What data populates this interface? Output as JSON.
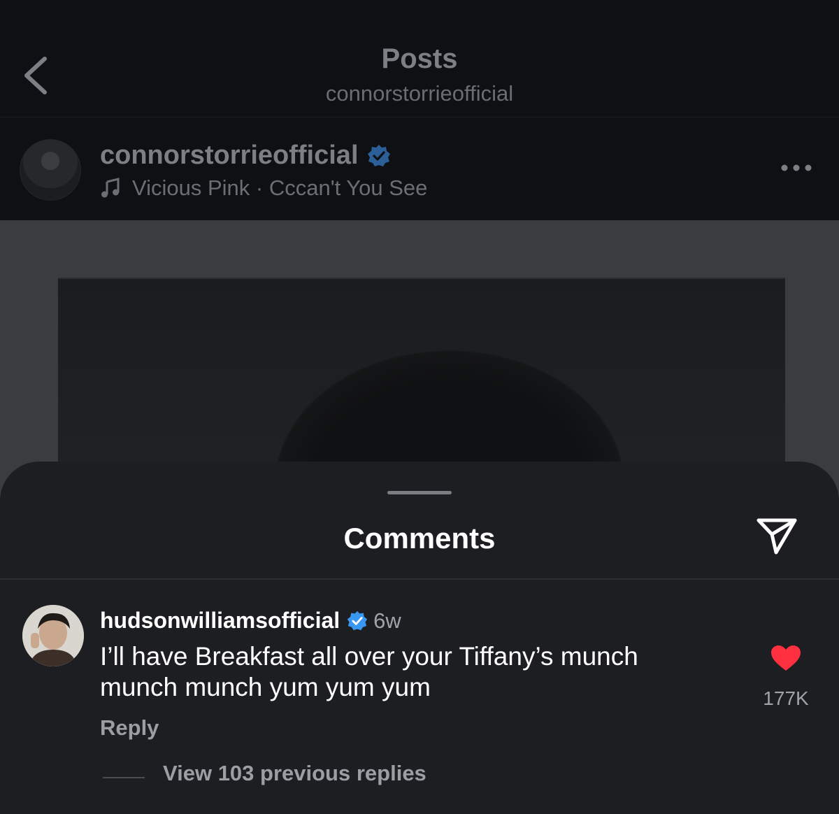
{
  "topbar": {
    "title": "Posts",
    "subtitle": "connorstorrieofficial"
  },
  "post": {
    "username": "connorstorrieofficial",
    "verified": true,
    "music": "Vicious Pink · Cccan't You See"
  },
  "comments_sheet": {
    "title": "Comments",
    "comments": [
      {
        "username": "hudsonwilliamsofficial",
        "verified": true,
        "time": "6w",
        "text": "I’ll have Breakfast all over your Tiffany’s munch munch munch yum yum yum",
        "reply_label": "Reply",
        "likes": "177K",
        "liked": true,
        "view_replies": "View 103 previous replies"
      }
    ]
  },
  "colors": {
    "sheet_bg": "#1c1e21",
    "verified_blue": "#3897f0",
    "like_red": "#ff3040"
  }
}
